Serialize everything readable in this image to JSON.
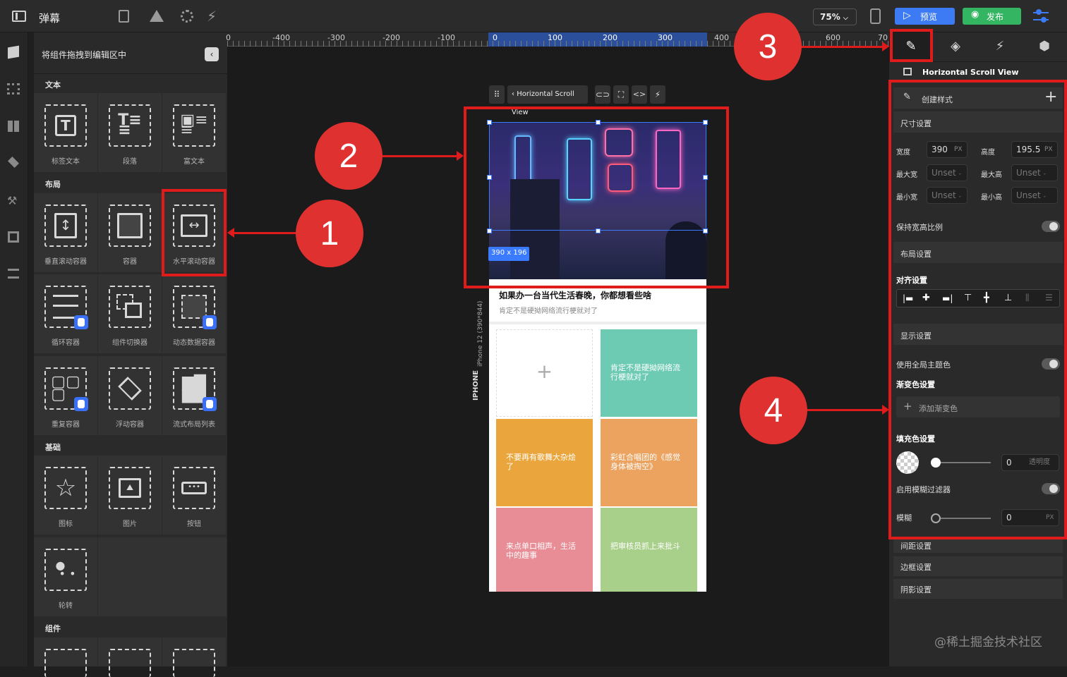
{
  "topbar": {
    "title": "弹幕",
    "zoom": "75%",
    "preview_label": "预览",
    "publish_label": "发布"
  },
  "leftpanel": {
    "header": "将组件拖拽到编辑区中",
    "sections": {
      "text": "文本",
      "layout": "布局",
      "basic": "基础",
      "components": "组件"
    },
    "text_items": [
      "标签文本",
      "段落",
      "富文本"
    ],
    "layout_items": [
      "垂直滚动容器",
      "容器",
      "水平滚动容器",
      "循环容器",
      "组件切换器",
      "动态数据容器",
      "重复容器",
      "浮动容器",
      "流式布局列表"
    ],
    "basic_items": [
      "图标",
      "图片",
      "按钮",
      "轮转"
    ]
  },
  "ruler": {
    "ticks": [
      "0",
      "-400",
      "-300",
      "-200",
      "-100",
      "0",
      "100",
      "200",
      "300",
      "400",
      "600",
      "70"
    ]
  },
  "canvas": {
    "toolbar_title": "Horizontal Scroll View",
    "size_badge": "390 x 196",
    "device_label": "IPHONE",
    "device_model": "iPhone 12 (390*844)",
    "article_title": "如果办一台当代生活春晚，你都想看些啥",
    "article_sub": "肯定不是硬拗网络流行梗就对了",
    "cards": [
      {
        "text": "",
        "color": "#ffffff"
      },
      {
        "text": "肯定不是硬拗网络流行梗就对了",
        "color": "#6dcbb4"
      },
      {
        "text": "不要再有歌舞大杂烩了",
        "color": "#eaa63c"
      },
      {
        "text": "彩虹合唱团的《感觉身体被掏空》",
        "color": "#eba35f"
      },
      {
        "text": "来点单口相声，生活中的趣事",
        "color": "#e88d96"
      },
      {
        "text": "把审核员抓上来批斗",
        "color": "#a9d08b"
      }
    ]
  },
  "callouts": [
    "1",
    "2",
    "3",
    "4"
  ],
  "rightpanel": {
    "component_name": "Horizontal Scroll View",
    "create_style": "创建样式",
    "size_section": "尺寸设置",
    "width_label": "宽度",
    "width_value": "390",
    "unit": "PX",
    "height_label": "高度",
    "height_value": "195.5",
    "max_w_label": "最大宽",
    "max_h_label": "最大高",
    "min_w_label": "最小宽",
    "min_h_label": "最小高",
    "unset": "Unset",
    "keep_ratio": "保持宽高比例",
    "layout_section": "布局设置",
    "align_section": "对齐设置",
    "display_section": "显示设置",
    "use_theme": "使用全局主题色",
    "gradient_section": "渐变色设置",
    "add_gradient": "添加渐变色",
    "fill_section": "填充色设置",
    "fill_value": "0",
    "opacity_label": "透明度",
    "blur_filter": "启用模糊过滤器",
    "blur_label": "模糊",
    "blur_value": "0",
    "spacing": "间距设置",
    "border": "边框设置",
    "shadow": "阴影设置"
  },
  "watermark": "@稀土掘金技术社区"
}
